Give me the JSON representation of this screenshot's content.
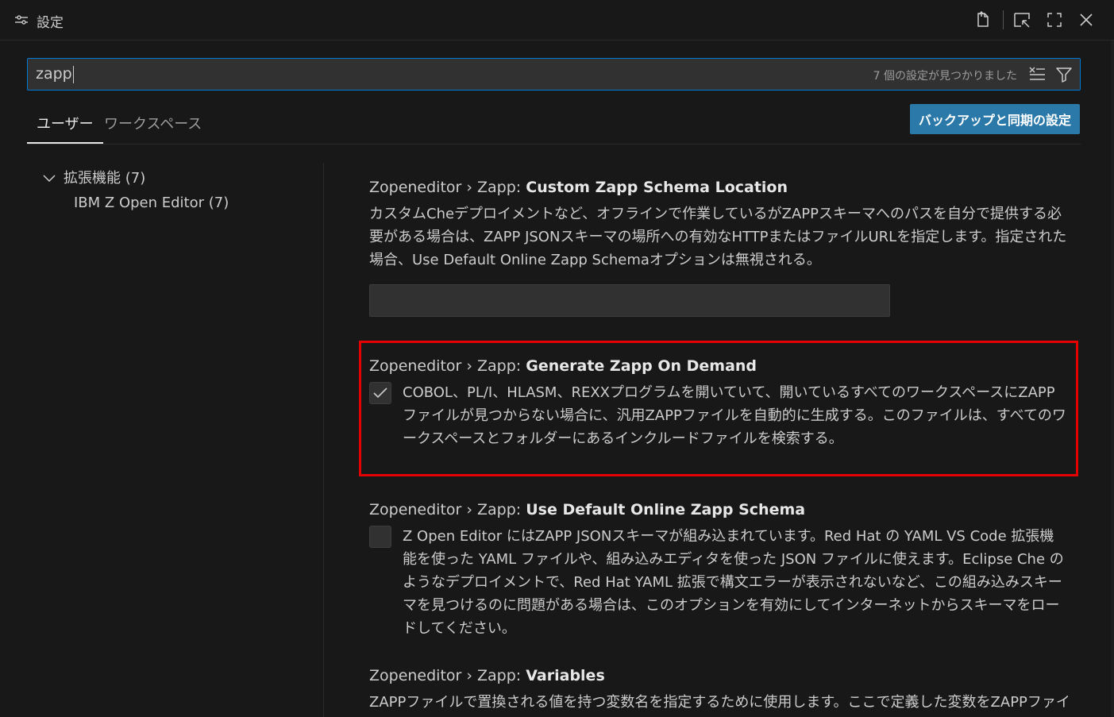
{
  "window": {
    "title": "設定",
    "icons": [
      "settings-sliders-icon",
      "open-json-icon",
      "split-editor-icon",
      "maximize-icon",
      "close-icon"
    ]
  },
  "search": {
    "value": "zapp",
    "result_count": "7 個の設定が見つかりました"
  },
  "tabs": [
    {
      "label": "ユーザー",
      "active": true
    },
    {
      "label": "ワークスペース",
      "active": false
    }
  ],
  "sync_button": "バックアップと同期の設定",
  "toc": {
    "group": "拡張機能 (7)",
    "item": "IBM Z Open Editor (7)"
  },
  "settings": [
    {
      "prefix": "Zopeneditor › Zapp: ",
      "name": "Custom Zapp Schema Location",
      "description": "カスタムCheデプロイメントなど、オフラインで作業しているがZAPPスキーマへのパスを自分で提供する必要がある場合は、ZAPP JSONスキーマの場所への有効なHTTPまたはファイルURLを指定します。指定された場合、Use Default Online Zapp Schemaオプションは無視される。",
      "input_value": ""
    },
    {
      "prefix": "Zopeneditor › Zapp: ",
      "name": "Generate Zapp On Demand",
      "checked": true,
      "description": "COBOL、PL/I、HLASM、REXXプログラムを開いていて、開いているすべてのワークスペースにZAPPファイルが見つからない場合に、汎用ZAPPファイルを自動的に生成する。このファイルは、すべてのワークスペースとフォルダーにあるインクルードファイルを検索する。"
    },
    {
      "prefix": "Zopeneditor › Zapp: ",
      "name": "Use Default Online Zapp Schema",
      "checked": false,
      "description": "Z Open Editor にはZAPP JSONスキーマが組み込まれています。Red Hat の YAML VS Code 拡張機能を使った YAML ファイルや、組み込みエディタを使った JSON ファイルに使えます。Eclipse Che のようなデプロイメントで、Red Hat YAML 拡張で構文エラーが表示されないなど、この組み込みスキーマを見つけるのに問題がある場合は、このオプションを有効にしてインターネットからスキーマをロードしてください。"
    },
    {
      "prefix": "Zopeneditor › Zapp: ",
      "name": "Variables",
      "description": "ZAPPファイルで置換される値を持つ変数名を指定するために使用します。ここで定義した変数をZAPPファイル"
    }
  ],
  "colors": {
    "background": "#181818",
    "accent": "#0078d4",
    "button": "#2b79a8",
    "highlight": "#e50000"
  }
}
